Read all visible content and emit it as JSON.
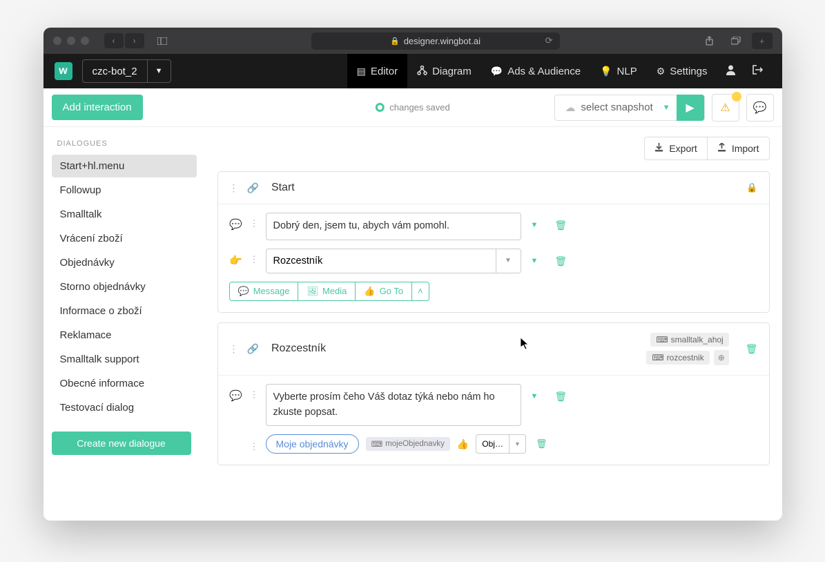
{
  "browser": {
    "url": "designer.wingbot.ai"
  },
  "appbar": {
    "logo_letter": "w",
    "bot_name": "czc-bot_2",
    "nav": {
      "editor": "Editor",
      "diagram": "Diagram",
      "ads": "Ads & Audience",
      "nlp": "NLP",
      "settings": "Settings"
    }
  },
  "toolbar": {
    "add_interaction": "Add interaction",
    "status": "changes saved",
    "snapshot": "select snapshot"
  },
  "export_label": "Export",
  "import_label": "Import",
  "sidebar": {
    "heading": "DIALOGUES",
    "items": [
      "Start+hl.menu",
      "Followup",
      "Smalltalk",
      "Vrácení zboží",
      "Objednávky",
      "Storno objednávky",
      "Informace o zboží",
      "Reklamace",
      "Smalltalk support",
      "Obecné informace",
      "Testovací dialog"
    ],
    "create": "Create new dialogue"
  },
  "cards": {
    "start": {
      "title": "Start",
      "message": "Dobrý den, jsem tu, abych vám pomohl.",
      "goto": "Rozcestník",
      "actions": {
        "message": "Message",
        "media": "Media",
        "goto": "Go To"
      }
    },
    "rozcestnik": {
      "title": "Rozcestník",
      "tag1": "smalltalk_ahoj",
      "tag2": "rozcestnik",
      "message": "Vyberte prosím čeho Váš dotaz týká nebo nám ho zkuste popsat.",
      "chip": "Moje objednávky",
      "chip_tag": "mojeObjednavky",
      "chip_goto": "Obj…"
    }
  }
}
